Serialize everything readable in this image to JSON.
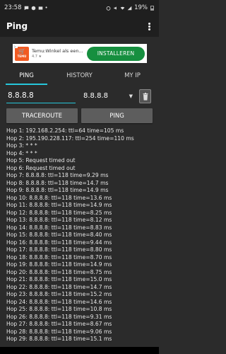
{
  "status_bar": {
    "time": "23:58",
    "battery": "19%"
  },
  "app_bar": {
    "title": "Ping",
    "menu_icon": "overflow-menu-icon"
  },
  "ad": {
    "logo_text": "TEMU",
    "title": "Temu:Winkel als een...",
    "rating": "4.7 ★",
    "install_label": "INSTALLEREN",
    "brand_color": "#f15a22",
    "install_color": "#168f3f"
  },
  "tabs": [
    {
      "label": "PING",
      "active": true
    },
    {
      "label": "HISTORY",
      "active": false
    },
    {
      "label": "MY IP",
      "active": false
    }
  ],
  "input": {
    "host_value": "8.8.8.8",
    "selected_host": "8.8.8.8"
  },
  "buttons": {
    "traceroute_label": "TRACEROUTE",
    "ping_label": "PING"
  },
  "accent_color": "#26c6da",
  "output_lines": [
    "Hop 1: 192.168.2.254: ttl=64 time=105 ms",
    "Hop 2: 195.190.228.117: ttl=254 time=110 ms",
    "Hop 3: * * *",
    "Hop 4: * * *",
    "Hop 5: Request timed out",
    "Hop 6: Request timed out",
    "Hop 7: 8.8.8.8: ttl=118 time=9.29 ms",
    "Hop 8: 8.8.8.8: ttl=118 time=14.7 ms",
    "Hop 9: 8.8.8.8: ttl=118 time=14.9 ms",
    "Hop 10: 8.8.8.8: ttl=118 time=13.6 ms",
    "Hop 11: 8.8.8.8: ttl=118 time=14.9 ms",
    "Hop 12: 8.8.8.8: ttl=118 time=8.25 ms",
    "Hop 13: 8.8.8.8: ttl=118 time=8.12 ms",
    "Hop 14: 8.8.8.8: ttl=118 time=8.83 ms",
    "Hop 15: 8.8.8.8: ttl=118 time=8.40 ms",
    "Hop 16: 8.8.8.8: ttl=118 time=9.44 ms",
    "Hop 17: 8.8.8.8: ttl=118 time=8.80 ms",
    "Hop 18: 8.8.8.8: ttl=118 time=8.70 ms",
    "Hop 19: 8.8.8.8: ttl=118 time=14.9 ms",
    "Hop 20: 8.8.8.8: ttl=118 time=8.75 ms",
    "Hop 21: 8.8.8.8: ttl=118 time=15.0 ms",
    "Hop 22: 8.8.8.8: ttl=118 time=14.7 ms",
    "Hop 23: 8.8.8.8: ttl=118 time=15.2 ms",
    "Hop 24: 8.8.8.8: ttl=118 time=14.6 ms",
    "Hop 25: 8.8.8.8: ttl=118 time=10.8 ms",
    "Hop 26: 8.8.8.8: ttl=118 time=9.31 ms",
    "Hop 27: 8.8.8.8: ttl=118 time=8.67 ms",
    "Hop 28: 8.8.8.8: ttl=118 time=9.06 ms",
    "Hop 29: 8.8.8.8: ttl=118 time=15.1 ms"
  ]
}
